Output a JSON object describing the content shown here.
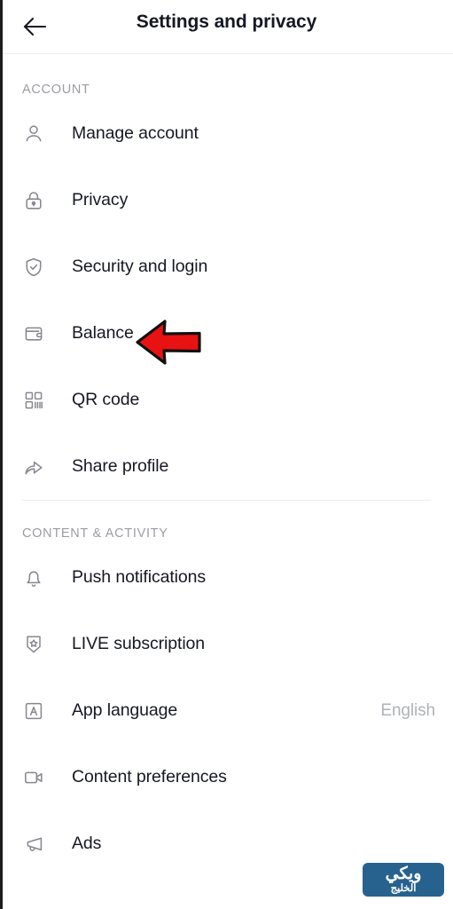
{
  "header": {
    "title": "Settings and privacy",
    "back_icon": "arrow-left-icon"
  },
  "sections": [
    {
      "id": "account",
      "label": "ACCOUNT",
      "items": [
        {
          "label": "Manage account",
          "icon": "person-icon",
          "value": ""
        },
        {
          "label": "Privacy",
          "icon": "lock-icon",
          "value": ""
        },
        {
          "label": "Security and login",
          "icon": "shield-check-icon",
          "value": ""
        },
        {
          "label": "Balance",
          "icon": "wallet-icon",
          "value": ""
        },
        {
          "label": "QR code",
          "icon": "qr-code-icon",
          "value": ""
        },
        {
          "label": "Share profile",
          "icon": "share-arrow-icon",
          "value": ""
        }
      ]
    },
    {
      "id": "content_activity",
      "label": "CONTENT & ACTIVITY",
      "items": [
        {
          "label": "Push notifications",
          "icon": "bell-icon",
          "value": ""
        },
        {
          "label": "LIVE subscription",
          "icon": "badge-star-icon",
          "value": ""
        },
        {
          "label": "App language",
          "icon": "letter-a-box-icon",
          "value": "English"
        },
        {
          "label": "Content preferences",
          "icon": "video-camera-icon",
          "value": ""
        },
        {
          "label": "Ads",
          "icon": "megaphone-icon",
          "value": ""
        }
      ]
    }
  ],
  "annotation": {
    "type": "arrow-left-annotation",
    "points_at": "Balance",
    "fill_color": "#e81212",
    "stroke_color": "#111111"
  },
  "watermark": {
    "line1": "ويكي",
    "line2": "الخليج",
    "background_color": "#27628f",
    "text_color": "#ffffff"
  },
  "colors": {
    "page_background": "#ffffff",
    "title_text": "#161823",
    "section_label": "#9b9da3",
    "row_label": "#161823",
    "row_value": "#b0b2b8",
    "icon": "#86888f",
    "divider": "#ededed"
  }
}
